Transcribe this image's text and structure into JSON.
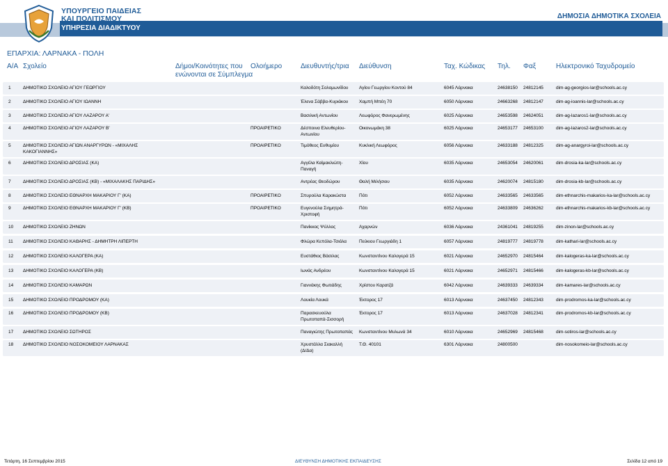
{
  "header": {
    "ministry_line1": "ΥΠΟΥΡΓΕΙΟ ΠΑΙΔΕΙΑΣ",
    "ministry_line2": "ΚΑΙ ΠΟΛΙΤΙΣΜΟΥ",
    "service": "ΥΠΗΡΕΣΙΑ ΔΙΑΔΙΚΤΥΟΥ",
    "doc_title": "ΔΗΜΟΣΙΑ ΔΗΜΟΤΙΚΑ ΣΧΟΛΕΙΑ",
    "region": "ΕΠΑΡΧΙΑ: ΛΑΡΝΑΚΑ - ΠΟΛΗ",
    "accent_color": "#1f5b97"
  },
  "columns": {
    "no": "Α/Α",
    "school": "Σχολείο",
    "communities_l1": "Δήμοι/Κοινότητες που",
    "communities_l2": "ενώνονται σε Σύμπλεγμα",
    "all_day": "Ολοήμερο",
    "director": "Διευθυντής/τρια",
    "address": "Διεύθυνση",
    "postcode": "Ταχ. Κώδικας",
    "phone": "Τηλ.",
    "fax": "Φαξ",
    "email": "Ηλεκτρονικό Ταχυδρομείο"
  },
  "rows": [
    {
      "no": "1",
      "school": "ΔΗΜΟΤΙΚΟ ΣΧΟΛΕΙΟ ΑΓΙΟΥ ΓΕΩΡΓΙΟΥ",
      "school2": "",
      "allday": "",
      "director": "Καλοδότη Σολομωνίδου",
      "director2": "",
      "address": "Αγίου Γεωργίου Κοντού 84",
      "postcode": "6045 Λάρνακα",
      "phone": "24638150",
      "fax": "24812145",
      "email": "dim-ag-georgios-lar@schools.ac.cy"
    },
    {
      "no": "2",
      "school": "ΔΗΜΟΤΙΚΟ ΣΧΟΛΕΙΟ ΑΓΙΟΥ ΙΩΑΝΝΗ",
      "school2": "",
      "allday": "",
      "director": "Έλενα Σάββα-Κυριάκου",
      "director2": "",
      "address": "Χαμπή Μπέη 70",
      "postcode": "6050 Λάρνακα",
      "phone": "24663268",
      "fax": "24812147",
      "email": "dim-ag-ioannis-lar@schools.ac.cy"
    },
    {
      "no": "3",
      "school": "ΔΗΜΟΤΙΚΟ ΣΧΟΛΕΙΟ ΑΓΙΟΥ ΛΑΖΑΡΟΥ Α'",
      "school2": "",
      "allday": "",
      "director": "Βασιλική Αντωνίου",
      "director2": "",
      "address": "Λεωφόρος Φανερωμένης",
      "postcode": "6025 Λάρνακα",
      "phone": "24653598",
      "fax": "24624051",
      "email": "dim-ag-lazaros1-lar@schools.ac.cy"
    },
    {
      "no": "4",
      "school": "ΔΗΜΟΤΙΚΟ ΣΧΟΛΕΙΟ ΑΓΙΟΥ ΛΑΖΑΡΟΥ Β'",
      "school2": "",
      "allday": "ΠΡΟΑΙΡΕΤΙΚΟ",
      "director": "Δέσποινα Ελευθερίου-",
      "director2": "Αντωνίου",
      "address": "Οικονωμάκη 38",
      "postcode": "6025 Λάρνακα",
      "phone": "24653177",
      "fax": "24653100",
      "email": "dim-ag-lazaros2-lar@schools.ac.cy"
    },
    {
      "no": "5",
      "school": "ΔΗΜΟΤΙΚΟ ΣΧΟΛΕΙΟ ΑΓΙΩΝ ΑΝΑΡΓΥΡΩΝ - «ΜΙΧΑΛΗΣ",
      "school2": "ΚΑΚΟΓΙΑΝΝΗΣ»",
      "allday": "ΠΡΟΑΙΡΕΤΙΚΟ",
      "director": "Τιμόθεος Ευθυμίου",
      "director2": "",
      "address": "Κυκλική Λεωφόρος",
      "postcode": "6056 Λάρνακα",
      "phone": "24633188",
      "fax": "24812325",
      "email": "dim-ag-anargyroi-lar@schools.ac.cy"
    },
    {
      "no": "6",
      "school": "ΔΗΜΟΤΙΚΟ ΣΧΟΛΕΙΟ ΔΡΟΣΙΑΣ (ΚΑ)",
      "school2": "",
      "allday": "",
      "director": "Αγγέλα Καϊμακλιώτη-",
      "director2": "Παναγή",
      "address": "Χίου",
      "postcode": "6035 Λάρνακα",
      "phone": "24653054",
      "fax": "24620061",
      "email": "dim-drosia-ka-lar@schools.ac.cy"
    },
    {
      "no": "7",
      "school": "ΔΗΜΟΤΙΚΟ ΣΧΟΛΕΙΟ ΔΡΟΣΙΑΣ (ΚΒ) - «ΜΙΧΑΛΑΚΗΣ ΠΑΡΙΔΗΣ»",
      "school2": "",
      "allday": "",
      "director": "Αντρέας Θεοδώρου",
      "director2": "",
      "address": "Θαλή Μιλήσιου",
      "postcode": "6035 Λάρνακα",
      "phone": "24620074",
      "fax": "24815180",
      "email": "dim-drosia-kb-lar@schools.ac.cy"
    },
    {
      "no": "8",
      "school": "ΔΗΜΟΤΙΚΟ ΣΧΟΛΕΙΟ ΕΘΝΑΡΧΗ ΜΑΚΑΡΙΟΥ Γ' (ΚΑ)",
      "school2": "",
      "allday": "ΠΡΟΑΙΡΕΤΙΚΟ",
      "director": "Σπυρούλα Καρακώστα",
      "director2": "",
      "address": "Πότι",
      "postcode": "6052 Λάρνακα",
      "phone": "24633565",
      "fax": "24633565",
      "email": "dim-ethnarchis-makarios-ka-lar@schools.ac.cy"
    },
    {
      "no": "9",
      "school": "ΔΗΜΟΤΙΚΟ ΣΧΟΛΕΙΟ ΕΘΝΑΡΧΗ ΜΑΚΑΡΙΟΥ Γ' (ΚΒ)",
      "school2": "",
      "allday": "ΠΡΟΑΙΡΕΤΙΚΟ",
      "director": "Ευγενούλα Σιημητρά-",
      "director2": "Χριστοφή",
      "address": "Πότι",
      "postcode": "6052 Λάρνακα",
      "phone": "24633809",
      "fax": "24636262",
      "email": "dim-ethnarchis-makarios-kb-lar@schools.ac.cy"
    },
    {
      "no": "10",
      "school": "ΔΗΜΟΤΙΚΟ ΣΧΟΛΕΙΟ ΖΗΝΩΝ",
      "school2": "",
      "allday": "",
      "director": "Πανίκκος Ψύλλος",
      "director2": "",
      "address": "Αχαρνών",
      "postcode": "6036 Λάρνακα",
      "phone": "24361041",
      "fax": "24819255",
      "email": "dim-zinon-lar@schools.ac.cy"
    },
    {
      "no": "11",
      "school": "ΔΗΜΟΤΙΚΟ ΣΧΟΛΕΙΟ ΚΑΘΑΡΗΣ - ΔΗΜΗΤΡΗ ΛΙΠΕΡΤΗ",
      "school2": "",
      "allday": "",
      "director": "Φλώρα Κεπόλα-Τσιόλα",
      "director2": "",
      "address": "Πεύκιου Γεωργιάδη 1",
      "postcode": "6057 Λάρνακα",
      "phone": "24819777",
      "fax": "24819778",
      "email": "dim-kathari-lar@schools.ac.cy"
    },
    {
      "no": "12",
      "school": "ΔΗΜΟΤΙΚΟ ΣΧΟΛΕΙΟ ΚΑΛΟΓΕΡΑ (ΚΑ)",
      "school2": "",
      "allday": "",
      "director": "Ευστάθιος Βάσιλας",
      "director2": "",
      "address": "Κωνσταντίνου Καλογερά 15",
      "postcode": "6021 Λάρνακα",
      "phone": "24652970",
      "fax": "24815464",
      "email": "dim-kalogeras-ka-lar@schools.ac.cy"
    },
    {
      "no": "13",
      "school": "ΔΗΜΟΤΙΚΟ ΣΧΟΛΕΙΟ ΚΑΛΟΓΕΡΑ (ΚΒ)",
      "school2": "",
      "allday": "",
      "director": "Ιωνάς Ανδρέου",
      "director2": "",
      "address": "Κωνσταντίνου Καλογερά 15",
      "postcode": "6021 Λάρνακα",
      "phone": "24652971",
      "fax": "24815466",
      "email": "dim-kalogeras-kb-lar@schools.ac.cy"
    },
    {
      "no": "14",
      "school": "ΔΗΜΟΤΙΚΟ ΣΧΟΛΕΙΟ ΚΑΜΑΡΩΝ",
      "school2": "",
      "allday": "",
      "director": "Γιαννάκης Φωτιάδης",
      "director2": "",
      "address": "Χρίστου Καρατζά",
      "postcode": "6042 Λάρνακα",
      "phone": "24639333",
      "fax": "24639334",
      "email": "dim-kamares-lar@schools.ac.cy"
    },
    {
      "no": "15",
      "school": "ΔΗΜΟΤΙΚΟ ΣΧΟΛΕΙΟ ΠΡΟΔΡΟΜΟΥ (ΚΑ)",
      "school2": "",
      "allday": "",
      "director": "Λουκία Λουκά",
      "director2": "",
      "address": "Έκτορος 17",
      "postcode": "6013 Λάρνακα",
      "phone": "24637450",
      "fax": "24812343",
      "email": "dim-prodromos-ka-lar@schools.ac.cy"
    },
    {
      "no": "16",
      "school": "ΔΗΜΟΤΙΚΟ ΣΧΟΛΕΙΟ ΠΡΟΔΡΟΜΟΥ (ΚΒ)",
      "school2": "",
      "allday": "",
      "director": "Παρασκευούλα",
      "director2": "Πρωτοπαπά-Σισσορή",
      "address": "Έκτορος 17",
      "postcode": "6013 Λάρνακα",
      "phone": "24637028",
      "fax": "24812341",
      "email": "dim-prodromos-kb-lar@schools.ac.cy"
    },
    {
      "no": "17",
      "school": "ΔΗΜΟΤΙΚΟ ΣΧΟΛΕΙΟ ΣΩΤΗΡΟΣ",
      "school2": "",
      "allday": "",
      "director": "Παναγιώτης Πρωτοπαπάς",
      "director2": "",
      "address": "Κωνσταντίνου Μυλωνά 34",
      "postcode": "6010 Λάρνακα",
      "phone": "24652969",
      "fax": "24815468",
      "email": "dim-sotiros-lar@schools.ac.cy"
    },
    {
      "no": "18",
      "school": "ΔΗΜΟΤΙΚΟ ΣΧΟΛΕΙΟ ΝΟΣΟΚΟΜΕΙΟΥ ΛΑΡΝΑΚΑΣ",
      "school2": "",
      "allday": "",
      "director": "Χρυστάλλα Σιακαλλή",
      "director2": "(Δ/Δα)",
      "address": "Τ.Θ. 40101",
      "postcode": "6301 Λάρνακα",
      "phone": "24800500",
      "fax": "",
      "email": "dim-nosokomeio-lar@schools.ac.cy"
    }
  ],
  "footer": {
    "date": "Τετάρτη, 16 Σεπτεμβρίου 2015",
    "department": "ΔΙΕΥΘΥΝΣΗ ΔΗΜΟΤΙΚΗΣ ΕΚΠΑΙΔΕΥΣΗΣ",
    "page": "Σελίδα 12 από 19"
  }
}
